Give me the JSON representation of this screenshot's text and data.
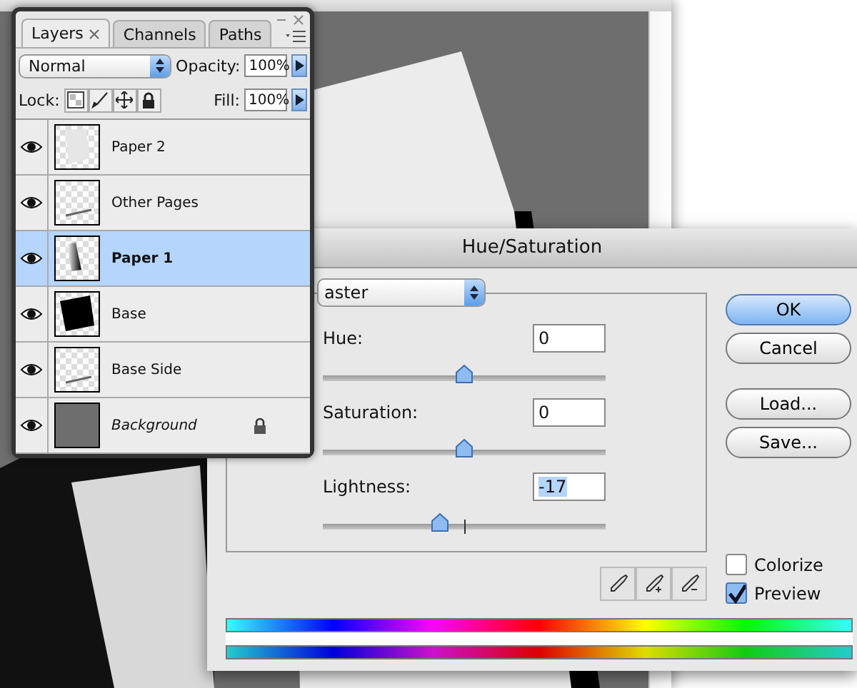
{
  "layers_panel": {
    "tabs": [
      {
        "label": "Layers",
        "selected": true,
        "closable": true
      },
      {
        "label": "Channels",
        "selected": false,
        "closable": false
      },
      {
        "label": "Paths",
        "selected": false,
        "closable": false
      }
    ],
    "blend_mode": "Normal",
    "opacity_label": "Opacity:",
    "opacity": "100%",
    "lock_label": "Lock:",
    "fill_label": "Fill:",
    "fill": "100%",
    "layers": [
      {
        "name": "Paper 2",
        "kind": "light-shape",
        "visible": true,
        "selected": false,
        "background": false,
        "locked": false
      },
      {
        "name": "Other Pages",
        "kind": "line",
        "visible": true,
        "selected": false,
        "background": false,
        "locked": false
      },
      {
        "name": "Paper 1",
        "kind": "dark-strip",
        "visible": true,
        "selected": true,
        "background": false,
        "locked": false
      },
      {
        "name": "Base",
        "kind": "black-square",
        "visible": true,
        "selected": false,
        "background": false,
        "locked": false
      },
      {
        "name": "Base Side",
        "kind": "line",
        "visible": true,
        "selected": false,
        "background": false,
        "locked": false
      },
      {
        "name": "Background",
        "kind": "solid-gray",
        "visible": true,
        "selected": false,
        "background": true,
        "locked": true
      }
    ]
  },
  "dialog": {
    "title": "Hue/Saturation",
    "edit": "aster",
    "adjustments": [
      {
        "label": "Hue:",
        "value": "0",
        "level": 0.5,
        "value_selected": false
      },
      {
        "label": "Saturation:",
        "value": "0",
        "level": 0.5,
        "value_selected": false
      },
      {
        "label": "Lightness:",
        "value": "-17",
        "level": 0.415,
        "value_selected": true
      }
    ],
    "buttons": [
      {
        "label": "OK",
        "default": true
      },
      {
        "label": "Cancel",
        "default": false
      },
      {
        "label": "Load...",
        "default": false
      },
      {
        "label": "Save...",
        "default": false
      }
    ],
    "options": [
      {
        "label": "Colorize",
        "checked": false
      },
      {
        "label": "Preview",
        "checked": true
      }
    ]
  }
}
